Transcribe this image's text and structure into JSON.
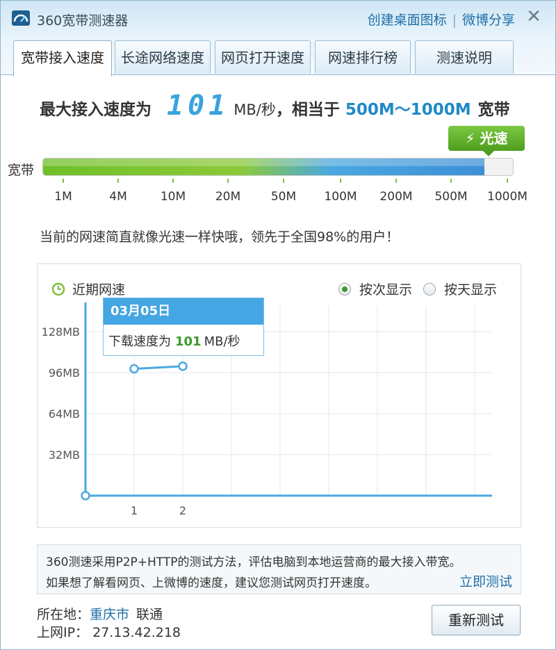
{
  "window": {
    "title": "360宽带测速器",
    "links": [
      "创建桌面图标",
      "微博分享"
    ],
    "close_glyph": "✕"
  },
  "tabs": [
    {
      "label": "宽带接入速度",
      "active": true
    },
    {
      "label": "长途网络速度",
      "active": false
    },
    {
      "label": "网页打开速度",
      "active": false
    },
    {
      "label": "网速排行榜",
      "active": false
    },
    {
      "label": "测速说明",
      "active": false
    }
  ],
  "result": {
    "prefix": "最大接入速度为",
    "speed_digits": "101",
    "unit": "MB/秒",
    "equiv_prefix": "，相当于",
    "range": "500M～1000M",
    "suffix": "宽带",
    "badge": "⚡ 光速"
  },
  "speed_bar": {
    "label": "宽带",
    "fill_percent": 94,
    "ticks": [
      "1M",
      "4M",
      "10M",
      "20M",
      "50M",
      "100M",
      "200M",
      "500M",
      "1000M"
    ]
  },
  "description": "当前的网速简直就像光速一样快哦，领先于全国98%的用户！",
  "recent_chart": {
    "title": "近期网速",
    "radio_options": [
      {
        "label": "按次显示",
        "checked": true
      },
      {
        "label": "按天显示",
        "checked": false
      }
    ],
    "tooltip": {
      "date": "03月05日",
      "text_prefix": "下载速度为",
      "value": "101",
      "unit": "MB/秒"
    }
  },
  "chart_data": {
    "type": "line",
    "x": [
      1,
      2
    ],
    "values": [
      99,
      101
    ],
    "xlabel": "",
    "ylabel": "",
    "y_tick_labels": [
      "128MB",
      "96MB",
      "64MB",
      "32MB"
    ],
    "y_ticks": [
      128,
      96,
      64,
      32
    ],
    "x_tick_labels": [
      "1",
      "2"
    ],
    "ylim": [
      0,
      128
    ],
    "xlim": [
      0,
      9
    ],
    "grid": true,
    "colors": {
      "line": "#4aa8e0",
      "axis": "#4aa8e0",
      "grid": "#e3e7ea"
    }
  },
  "info": {
    "line1": "360测速采用P2P+HTTP的测试方法，评估电脑到本地运营商的最大接入带宽。",
    "line2": "如果想了解看网页、上微博的速度，建议您测试网页打开速度。",
    "link": "立即测试"
  },
  "location": {
    "label": "所在地：",
    "city": "重庆市",
    "isp": "联通",
    "ip_label": "上网IP：",
    "ip": "27.13.42.218"
  },
  "retest_button": "重新测试",
  "colors": {
    "accent": "#1f6fa8",
    "green": "#3a9a2a",
    "tooltip_header": "#44a6e2"
  }
}
